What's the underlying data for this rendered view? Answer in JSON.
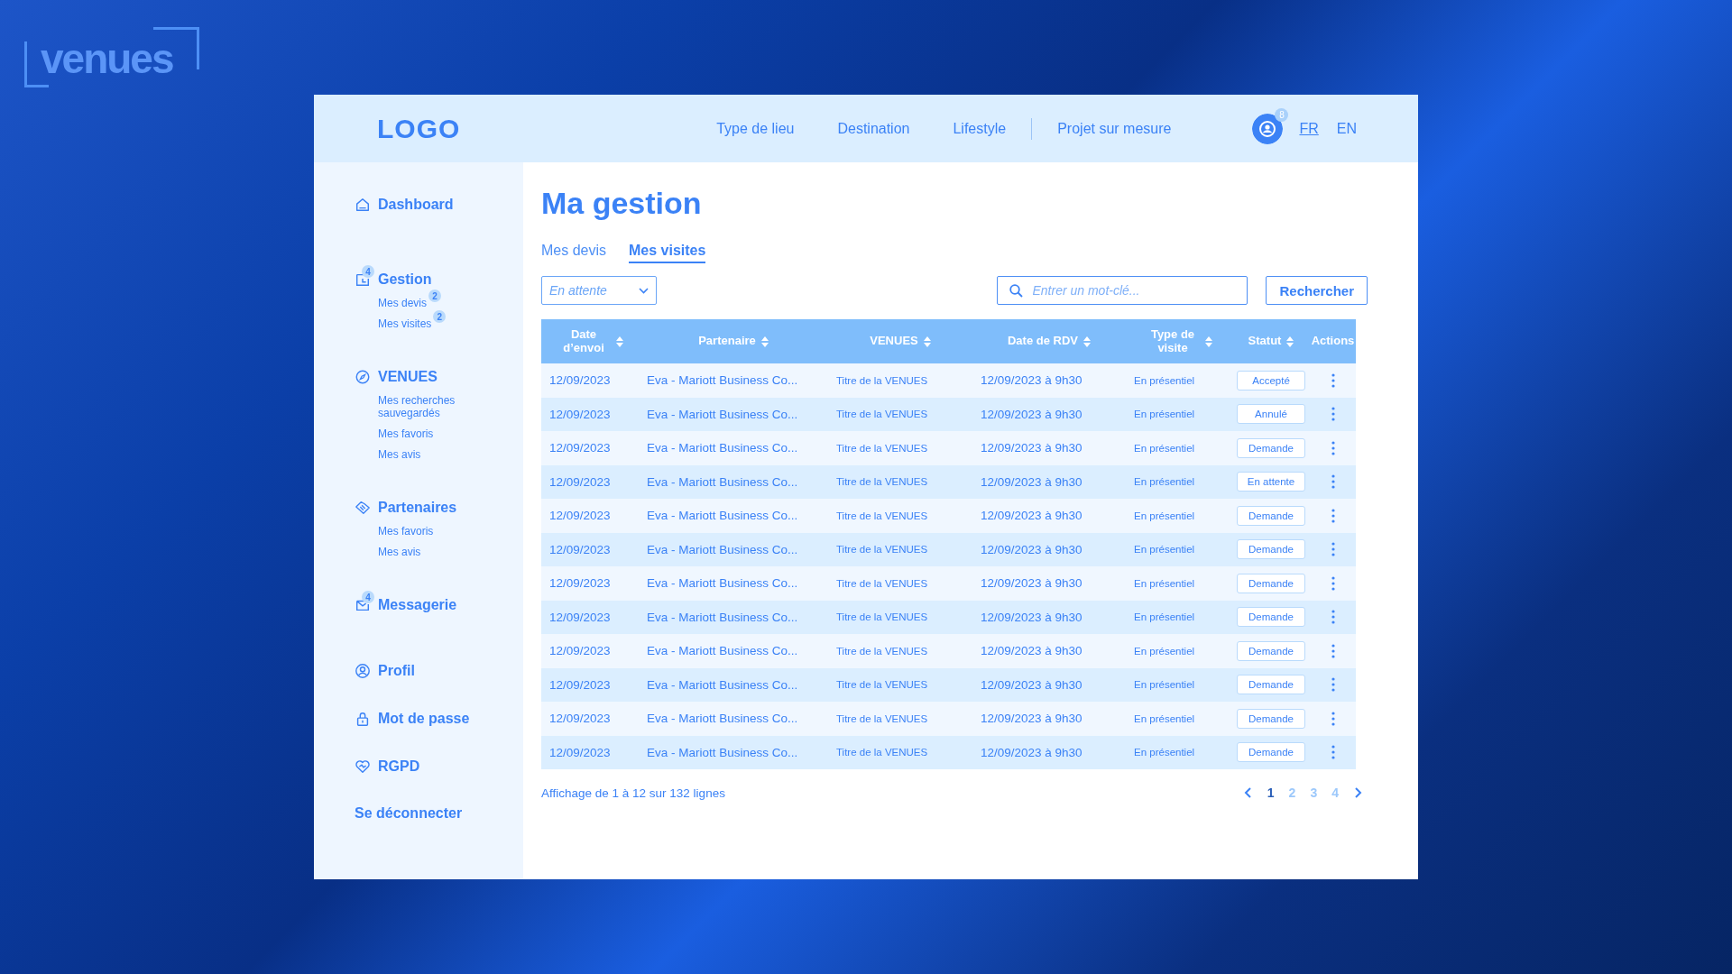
{
  "brand": {
    "name": "venues"
  },
  "header": {
    "logo": "LOGO",
    "nav": [
      {
        "label": "Type de lieu"
      },
      {
        "label": "Destination"
      },
      {
        "label": "Lifestyle"
      },
      {
        "label": "Projet sur mesure"
      }
    ],
    "notifications": "8",
    "languages": [
      {
        "label": "FR",
        "selected": true
      },
      {
        "label": "EN",
        "selected": false
      }
    ]
  },
  "sidebar": {
    "sections": [
      {
        "kind": "home",
        "label": "Dashboard"
      },
      {
        "kind": "folder",
        "label": "Gestion",
        "badge": "4",
        "children": [
          {
            "label": "Mes devis",
            "badge": "2"
          },
          {
            "label": "Mes visites",
            "badge": "2"
          }
        ]
      },
      {
        "kind": "compass",
        "label": "VENUES",
        "children": [
          {
            "label": "Mes recherches sauvegardés"
          },
          {
            "label": "Mes favoris"
          },
          {
            "label": "Mes avis"
          }
        ]
      },
      {
        "kind": "handshake",
        "label": "Partenaires",
        "children": [
          {
            "label": "Mes favoris"
          },
          {
            "label": "Mes avis"
          }
        ]
      },
      {
        "kind": "mail",
        "label": "Messagerie",
        "badge": "4"
      },
      {
        "kind": "user",
        "label": "Profil"
      },
      {
        "kind": "lock",
        "label": "Mot de passe"
      },
      {
        "kind": "heart",
        "label": "RGPD"
      }
    ],
    "logout": "Se déconnecter"
  },
  "main": {
    "title": "Ma gestion",
    "tabs": [
      {
        "label": "Mes devis",
        "selected": false
      },
      {
        "label": "Mes visites",
        "selected": true
      }
    ],
    "filter": {
      "value": "En attente"
    },
    "search": {
      "placeholder": "Entrer un mot-clé..."
    },
    "search_button": "Rechercher",
    "table": {
      "columns": [
        {
          "label": "Date d’envoi",
          "sortable": true
        },
        {
          "label": "Partenaire",
          "sortable": true
        },
        {
          "label": "VENUES",
          "sortable": true
        },
        {
          "label": "Date de RDV",
          "sortable": true
        },
        {
          "label": "Type de visite",
          "sortable": true
        },
        {
          "label": "Statut",
          "sortable": true
        },
        {
          "label": "Actions",
          "sortable": false
        }
      ],
      "rows": [
        {
          "date": "12/09/2023",
          "partner": "Eva - Mariott Business Co...",
          "venue": "Titre de la VENUES",
          "rdv": "12/09/2023 à 9h30",
          "type": "En présentiel",
          "status": "Accepté"
        },
        {
          "date": "12/09/2023",
          "partner": "Eva - Mariott Business Co...",
          "venue": "Titre de la VENUES",
          "rdv": "12/09/2023 à 9h30",
          "type": "En présentiel",
          "status": "Annulé"
        },
        {
          "date": "12/09/2023",
          "partner": "Eva - Mariott Business Co...",
          "venue": "Titre de la VENUES",
          "rdv": "12/09/2023 à 9h30",
          "type": "En présentiel",
          "status": "Demande"
        },
        {
          "date": "12/09/2023",
          "partner": "Eva - Mariott Business Co...",
          "venue": "Titre de la VENUES",
          "rdv": "12/09/2023 à 9h30",
          "type": "En présentiel",
          "status": "En attente"
        },
        {
          "date": "12/09/2023",
          "partner": "Eva - Mariott Business Co...",
          "venue": "Titre de la VENUES",
          "rdv": "12/09/2023 à 9h30",
          "type": "En présentiel",
          "status": "Demande"
        },
        {
          "date": "12/09/2023",
          "partner": "Eva - Mariott Business Co...",
          "venue": "Titre de la VENUES",
          "rdv": "12/09/2023 à 9h30",
          "type": "En présentiel",
          "status": "Demande"
        },
        {
          "date": "12/09/2023",
          "partner": "Eva - Mariott Business Co...",
          "venue": "Titre de la VENUES",
          "rdv": "12/09/2023 à 9h30",
          "type": "En présentiel",
          "status": "Demande"
        },
        {
          "date": "12/09/2023",
          "partner": "Eva - Mariott Business Co...",
          "venue": "Titre de la VENUES",
          "rdv": "12/09/2023 à 9h30",
          "type": "En présentiel",
          "status": "Demande"
        },
        {
          "date": "12/09/2023",
          "partner": "Eva - Mariott Business Co...",
          "venue": "Titre de la VENUES",
          "rdv": "12/09/2023 à 9h30",
          "type": "En présentiel",
          "status": "Demande"
        },
        {
          "date": "12/09/2023",
          "partner": "Eva - Mariott Business Co...",
          "venue": "Titre de la VENUES",
          "rdv": "12/09/2023 à 9h30",
          "type": "En présentiel",
          "status": "Demande"
        },
        {
          "date": "12/09/2023",
          "partner": "Eva - Mariott Business Co...",
          "venue": "Titre de la VENUES",
          "rdv": "12/09/2023 à 9h30",
          "type": "En présentiel",
          "status": "Demande"
        },
        {
          "date": "12/09/2023",
          "partner": "Eva - Mariott Business Co...",
          "venue": "Titre de la VENUES",
          "rdv": "12/09/2023 à 9h30",
          "type": "En présentiel",
          "status": "Demande"
        }
      ]
    },
    "summary": "Affichage de 1 à 12 sur 132 lignes",
    "pagination": [
      {
        "label": "1",
        "selected": true
      },
      {
        "label": "2",
        "selected": false
      },
      {
        "label": "3",
        "selected": false
      },
      {
        "label": "4",
        "selected": false
      }
    ]
  }
}
